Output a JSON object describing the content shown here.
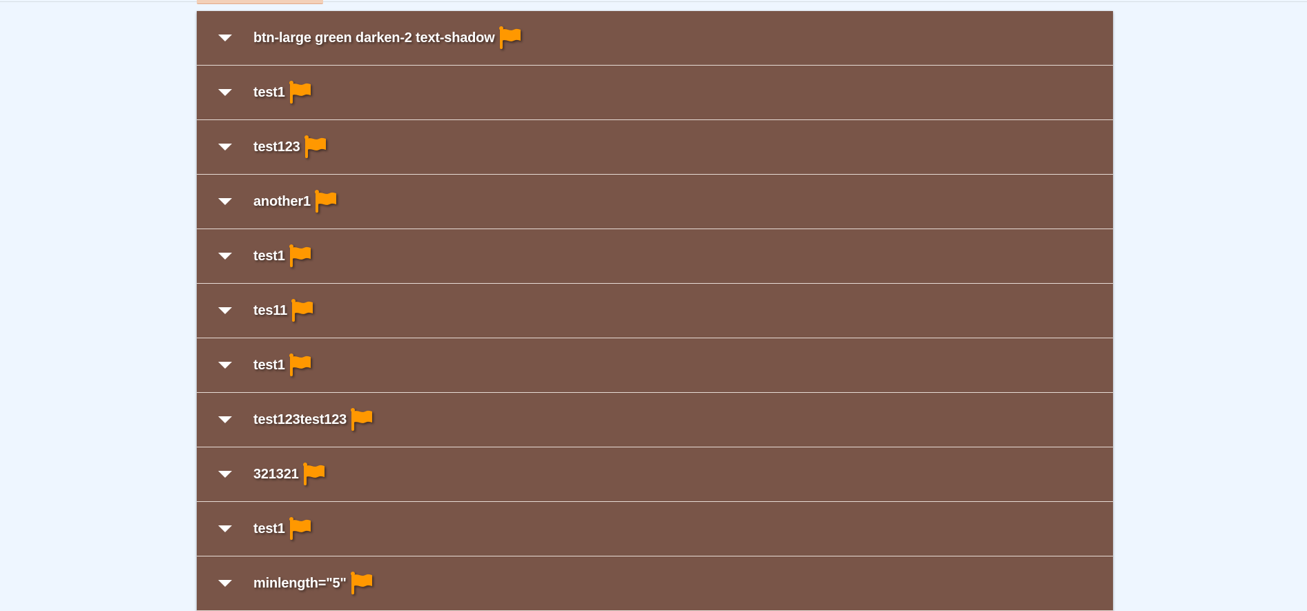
{
  "colors": {
    "page_background": "#eef6ff",
    "row_background": "#795548",
    "divider": "#e8dcd6",
    "text": "#ffffff",
    "flag": "#ff9800"
  },
  "collapsible": {
    "items": [
      {
        "label": "btn-large green darken-2 text-shadow",
        "expand_icon": "caret-down-icon",
        "badge_icon": "flag-icon"
      },
      {
        "label": "test1",
        "expand_icon": "caret-down-icon",
        "badge_icon": "flag-icon"
      },
      {
        "label": "test123",
        "expand_icon": "caret-down-icon",
        "badge_icon": "flag-icon"
      },
      {
        "label": "another1",
        "expand_icon": "caret-down-icon",
        "badge_icon": "flag-icon"
      },
      {
        "label": "test1",
        "expand_icon": "caret-down-icon",
        "badge_icon": "flag-icon"
      },
      {
        "label": "tes11",
        "expand_icon": "caret-down-icon",
        "badge_icon": "flag-icon"
      },
      {
        "label": "test1",
        "expand_icon": "caret-down-icon",
        "badge_icon": "flag-icon"
      },
      {
        "label": "test123test123",
        "expand_icon": "caret-down-icon",
        "badge_icon": "flag-icon"
      },
      {
        "label": "321321",
        "expand_icon": "caret-down-icon",
        "badge_icon": "flag-icon"
      },
      {
        "label": "test1",
        "expand_icon": "caret-down-icon",
        "badge_icon": "flag-icon"
      },
      {
        "label": "minlength=\"5\"",
        "expand_icon": "caret-down-icon",
        "badge_icon": "flag-icon"
      }
    ]
  }
}
